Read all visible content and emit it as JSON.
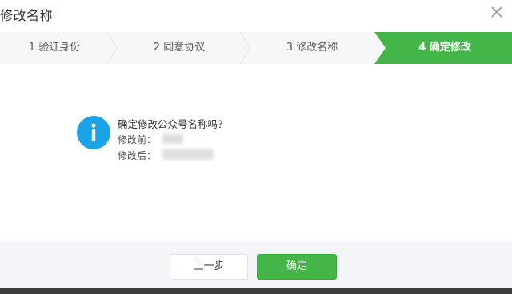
{
  "dialog": {
    "title": "修改名称",
    "close_icon": "close-icon"
  },
  "steps": [
    {
      "label": "1 验证身份",
      "active": false
    },
    {
      "label": "2 同意协议",
      "active": false
    },
    {
      "label": "3 修改名称",
      "active": false
    },
    {
      "label": "4 确定修改",
      "active": true
    }
  ],
  "message": {
    "icon": "info-icon",
    "question": "确定修改公众号名称吗？",
    "before_label": "修改前：",
    "after_label": "修改后："
  },
  "buttons": {
    "prev": "上一步",
    "confirm": "确定"
  },
  "colors": {
    "accent_green": "#44b549",
    "info_blue": "#1aa3e6"
  }
}
